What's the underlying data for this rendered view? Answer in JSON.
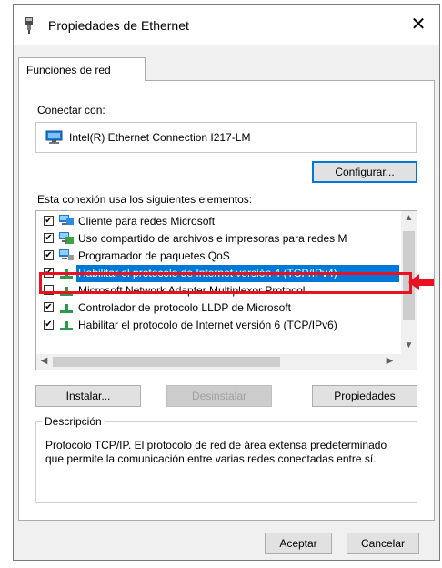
{
  "window": {
    "title": "Propiedades de Ethernet",
    "close_glyph": "✕",
    "icon": "network-adapter-icon"
  },
  "tab": {
    "label": "Funciones de red"
  },
  "connect": {
    "label": "Conectar con:",
    "adapter_name": "Intel(R) Ethernet Connection I217-LM",
    "adapter_icon": "monitor-network-icon",
    "configure_label": "Configurar..."
  },
  "items": {
    "label": "Esta conexión usa los siguientes elementos:",
    "list": [
      {
        "checked": true,
        "icon": "network-client-icon",
        "text": "Cliente para redes Microsoft",
        "selected": false
      },
      {
        "checked": true,
        "icon": "file-sharing-icon",
        "text": "Uso compartido de archivos e impresoras para redes M",
        "selected": false
      },
      {
        "checked": true,
        "icon": "qos-scheduler-icon",
        "text": "Programador de paquetes QoS",
        "selected": false
      },
      {
        "checked": true,
        "icon": "protocol-icon",
        "text": "Habilitar el protocolo de Internet versión 4 (TCP/IPv4)",
        "selected": true
      },
      {
        "checked": false,
        "icon": "protocol-icon",
        "text": "Microsoft Network Adapter Multiplexor Protocol",
        "selected": false
      },
      {
        "checked": true,
        "icon": "protocol-icon",
        "text": "Controlador de protocolo LLDP de Microsoft",
        "selected": false
      },
      {
        "checked": true,
        "icon": "protocol-icon",
        "text": "Habilitar el protocolo de Internet versión 6 (TCP/IPv6)",
        "selected": false
      }
    ]
  },
  "buttons": {
    "install": "Instalar...",
    "uninstall": "Desinstalar",
    "properties": "Propiedades",
    "ok": "Aceptar",
    "cancel": "Cancelar"
  },
  "description": {
    "legend": "Descripción",
    "text": "Protocolo TCP/IP. El protocolo de red de área extensa predeterminado que permite la comunicación entre varias redes conectadas entre sí."
  },
  "colors": {
    "selection": "#0078d7",
    "annotation_red": "#e81123"
  }
}
